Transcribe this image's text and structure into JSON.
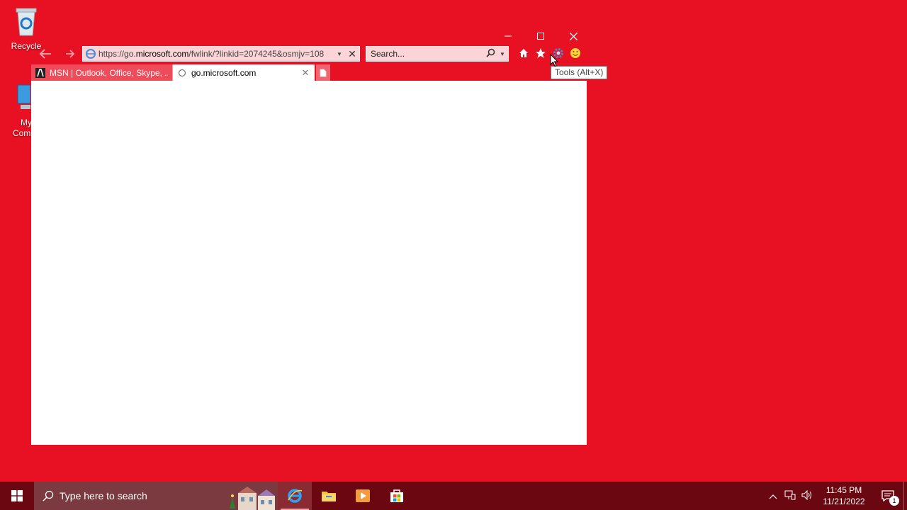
{
  "desktop": {
    "icons": [
      {
        "label": "Recycle"
      },
      {
        "label_line1": "My",
        "label_line2": "Comp"
      }
    ]
  },
  "browser": {
    "address": {
      "url_prefix": "https://go.",
      "url_domain": "microsoft.com",
      "url_rest": "/fwlink/?linkid=2074245&osmjv=108"
    },
    "search": {
      "placeholder": "Search..."
    },
    "tabs": [
      {
        "label": "MSN | Outlook, Office, Skype, ...",
        "active": false
      },
      {
        "label": "go.microsoft.com",
        "active": true
      }
    ],
    "tooltip": "Tools (Alt+X)",
    "colors": {
      "accent": "#e81123",
      "content": "#ffffff"
    }
  },
  "taskbar": {
    "search_placeholder": "Type here to search",
    "apps": [
      "internet-explorer-icon",
      "file-explorer-icon",
      "media-player-icon",
      "store-icon"
    ],
    "clock": {
      "time": "11:45 PM",
      "date": "11/21/2022"
    },
    "notification_count": "1",
    "color": "#6b0710"
  }
}
